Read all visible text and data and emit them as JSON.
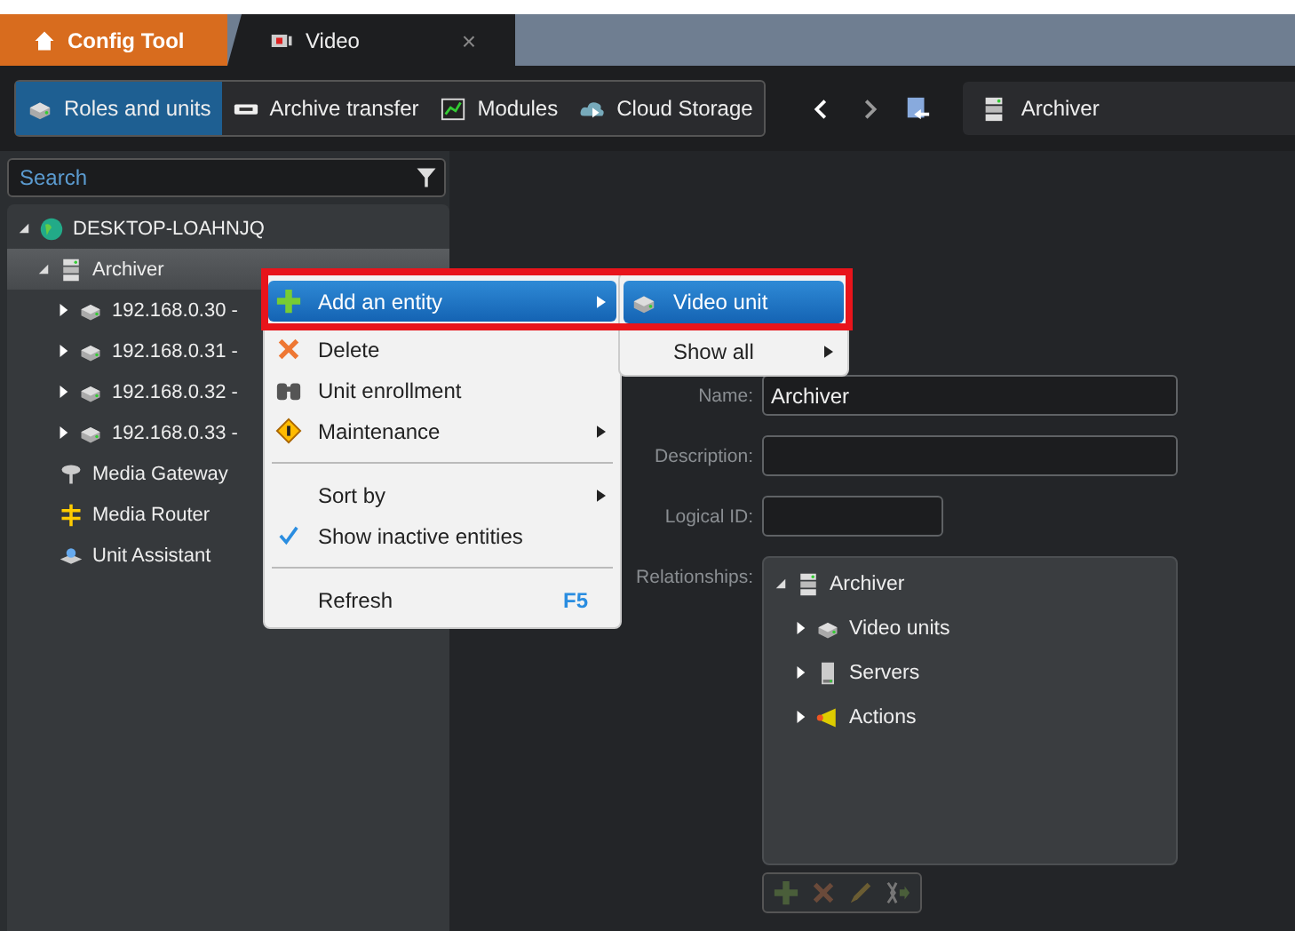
{
  "tabs": [
    {
      "label": "Config Tool",
      "kind": "home",
      "selected": false
    },
    {
      "label": "Video",
      "kind": "video",
      "selected": true,
      "close": "×"
    }
  ],
  "toolbar": {
    "tasks": [
      {
        "label": "Roles and units",
        "kind": "unit",
        "selected": true
      },
      {
        "label": "Archive transfer",
        "kind": "transfer",
        "selected": false
      },
      {
        "label": "Modules",
        "kind": "chart",
        "selected": false
      },
      {
        "label": "Cloud Storage",
        "kind": "cloud",
        "selected": false
      }
    ],
    "breadcrumb": "Archiver"
  },
  "search": {
    "placeholder": "Search"
  },
  "tree": [
    {
      "label": "DESKTOP-LOAHNJQ",
      "kind": "globe",
      "expanded": true,
      "selected": false,
      "children": [
        {
          "label": "Archiver",
          "kind": "server",
          "expanded": true,
          "selected": true,
          "children": [
            {
              "label": "192.168.0.30 -",
              "kind": "unit",
              "expanded": false,
              "selected": false
            },
            {
              "label": "192.168.0.31 -",
              "kind": "unit",
              "expanded": false,
              "selected": false
            },
            {
              "label": "192.168.0.32 -",
              "kind": "unit",
              "expanded": false,
              "selected": false
            },
            {
              "label": "192.168.0.33 -",
              "kind": "unit",
              "expanded": false,
              "selected": false
            }
          ]
        },
        {
          "label": "Media Gateway",
          "kind": "dish",
          "selected": false
        },
        {
          "label": "Media Router",
          "kind": "router",
          "selected": false
        },
        {
          "label": "Unit Assistant",
          "kind": "assist",
          "selected": false
        }
      ]
    }
  ],
  "form": {
    "fields": [
      {
        "label": "Name:",
        "value": "Archiver",
        "kind": "wide"
      },
      {
        "label": "Description:",
        "kind": "wide"
      },
      {
        "label": "Logical ID:",
        "kind": "short"
      }
    ],
    "relationships_label": "Relationships:",
    "relationships": [
      {
        "label": "Archiver",
        "kind": "server",
        "expanded": true,
        "children": [
          {
            "label": "Video units",
            "kind": "unit",
            "expanded": false
          },
          {
            "label": "Servers",
            "kind": "tower",
            "expanded": false
          },
          {
            "label": "Actions",
            "kind": "horn",
            "expanded": false
          }
        ]
      }
    ]
  },
  "context_menu": [
    {
      "kind": "plus",
      "label": "Add an entity",
      "submenu": true,
      "selected": true
    },
    {
      "kind": "cross",
      "label": "Delete",
      "submenu": false,
      "selected": false
    },
    {
      "kind": "binoculars",
      "label": "Unit enrollment",
      "submenu": false,
      "selected": false
    },
    {
      "kind": "warning",
      "label": "Maintenance",
      "submenu": true,
      "selected": false
    },
    {
      "kind": "separator"
    },
    {
      "kind": "plain",
      "label": "Sort by",
      "submenu": true,
      "selected": false
    },
    {
      "kind": "plain",
      "label": "Show inactive entities",
      "checked": true,
      "submenu": false,
      "selected": false
    },
    {
      "kind": "separator"
    },
    {
      "kind": "plain",
      "label": "Refresh",
      "shortcut": "F5",
      "submenu": false,
      "selected": false
    }
  ],
  "submenu": [
    {
      "kind": "unit",
      "label": "Video unit",
      "submenu": false,
      "selected": true
    },
    {
      "kind": "plain",
      "label": "Show all",
      "submenu": true,
      "selected": false
    }
  ]
}
